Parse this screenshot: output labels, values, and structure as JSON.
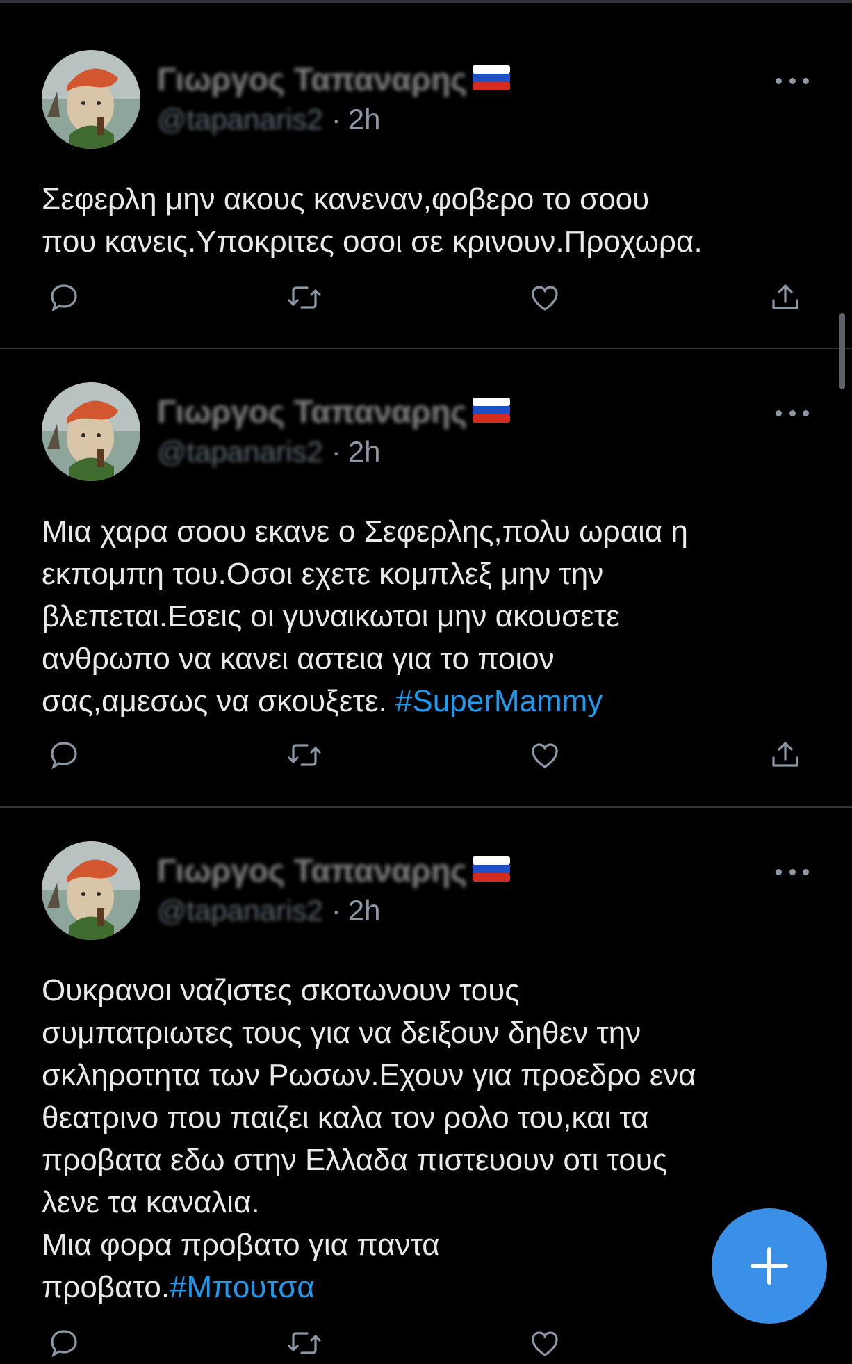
{
  "tweets": [
    {
      "display_name": "Γιωργος Ταπαναρης",
      "flag": "🇷🇺",
      "handle": "@tapanaris2",
      "time": "2h",
      "separator": "·",
      "text": "Σεφερλη μην ακους κανεναν,φοβερο το σοου\nπου κανεις.Υποκριτες οσοι σε κρινουν.Προχωρα.",
      "hashtag": ""
    },
    {
      "display_name": "Γιωργος Ταπαναρης",
      "flag": "🇷🇺",
      "handle": "@tapanaris2",
      "time": "2h",
      "separator": "·",
      "text": "Μια χαρα σοου εκανε ο Σεφερλης,πολυ ωραια η\nεκπομπη του.Οσοι εχετε κομπλεξ μην την\nβλεπεται.Εσεις οι γυναικωτοι μην ακουσετε\nανθρωπο να κανει αστεια για το ποιον\nσας,αμεσως να σκουξετε. ",
      "hashtag": "#SuperMammy"
    },
    {
      "display_name": "Γιωργος Ταπαναρης",
      "flag": "🇷🇺",
      "handle": "@tapanaris2",
      "time": "2h",
      "separator": "·",
      "text": "Ουκρανοι ναζιστες σκοτωνουν τους\nσυμπατριωτες τους για να δειξουν δηθεν την\nσκληροτητα των Ρωσων.Εχουν για προεδρο ενα\nθεατρινο που παιζει καλα τον ρολο του,και τα\nπροβατα εδω στην Ελλαδα πιστευουν οτι τους\nλενε τα καναλια.\nΜια φορα προβατο για παντα\nπροβατο.",
      "hashtag": "#Μπουτσα"
    }
  ],
  "icons": {
    "reply": "reply-icon",
    "retweet": "retweet-icon",
    "like": "like-icon",
    "share": "share-icon",
    "more": "more-icon",
    "compose": "compose-plus-icon"
  },
  "colors": {
    "background": "#000000",
    "text": "#e7e9ea",
    "secondary": "#8b98a5",
    "accent": "#1d9bf0",
    "fab": "#3a8fe6",
    "divider": "#2f3336"
  }
}
